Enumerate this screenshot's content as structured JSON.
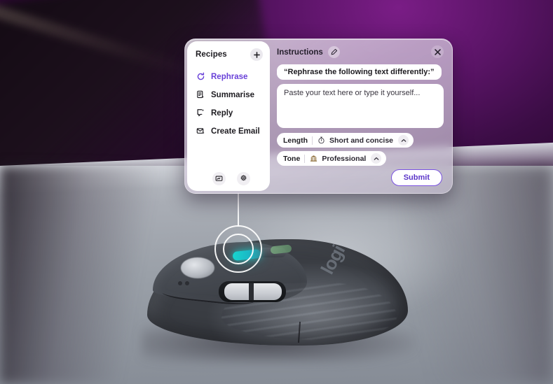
{
  "scene": {
    "subject": "wireless-mouse-on-desk",
    "brand_text": "logi",
    "highlight_color": "#17d6cf",
    "backdrop_color": "#5a1466",
    "desk_color": "#9aa0a8"
  },
  "panel": {
    "sidebar": {
      "title": "Recipes",
      "add_label": "+",
      "add_icon": "plus-icon",
      "items": [
        {
          "label": "Rephrase",
          "icon": "rotate-arrow-icon",
          "active": true
        },
        {
          "label": "Summarise",
          "icon": "document-sparkle-icon",
          "active": false
        },
        {
          "label": "Reply",
          "icon": "chat-bubble-sparkle-icon",
          "active": false
        },
        {
          "label": "Create Email",
          "icon": "envelope-sparkle-icon",
          "active": false
        }
      ],
      "footer": [
        {
          "icon": "display-icon"
        },
        {
          "icon": "gear-icon"
        }
      ],
      "active_color": "#6941d8"
    },
    "content": {
      "title": "Instructions",
      "edit_icon": "pencil-icon",
      "close_icon": "close-icon",
      "prompt": "“Rephrase the following text differently:”",
      "textarea_placeholder": "Paste your text here or type it yourself...",
      "textarea_value": "",
      "options": [
        {
          "key": "Length",
          "value": "Short and concise",
          "icon": "stopwatch-icon",
          "caret_icon": "chevron-up-icon"
        },
        {
          "key": "Tone",
          "value": "Professional",
          "icon": "briefcase-building-icon",
          "caret_icon": "chevron-up-icon"
        }
      ],
      "submit_label": "Submit",
      "submit_accent": "#7a52e0"
    }
  }
}
